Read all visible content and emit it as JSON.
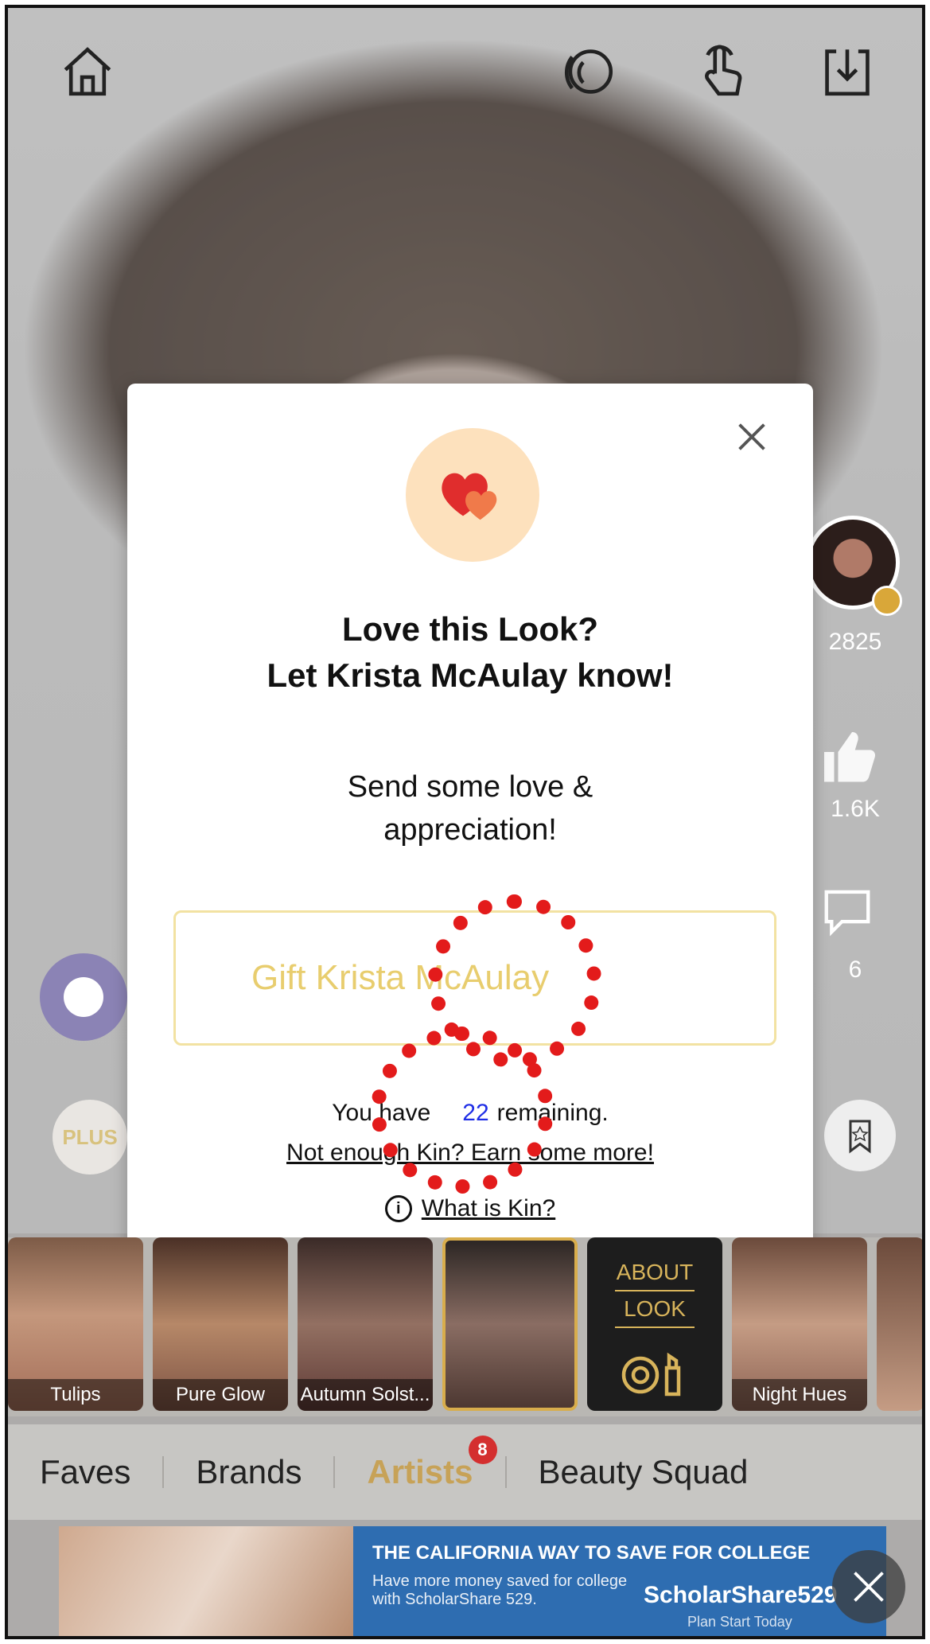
{
  "modal": {
    "title_line1": "Love this Look?",
    "title_line2": "Let Krista McAulay know!",
    "subtitle_line1": "Send some love &",
    "subtitle_line2": "appreciation!",
    "gift_button_label": "Gift Krista McAulay",
    "kin_prefix": "You have",
    "kin_count": "22",
    "kin_suffix": "remaining.",
    "earn_link": "Not enough Kin? Earn some more!",
    "what_is_kin": "What is Kin?"
  },
  "side": {
    "follower_count": "2825",
    "like_count": "1.6K",
    "comment_count": "6",
    "plus_label": "PLUS"
  },
  "thumbnails": [
    {
      "label": "Tulips"
    },
    {
      "label": "Pure Glow"
    },
    {
      "label": "Autumn Solst..."
    },
    {
      "label": ""
    },
    {
      "label": ""
    },
    {
      "label": "Night Hues"
    }
  ],
  "about_look": {
    "line1": "ABOUT",
    "line2": "LOOK"
  },
  "tabs": [
    {
      "label": "Faves"
    },
    {
      "label": "Brands"
    },
    {
      "label": "Artists",
      "badge": "8"
    },
    {
      "label": "Beauty Squad"
    }
  ],
  "ad": {
    "headline": "THE CALIFORNIA WAY TO SAVE FOR COLLEGE",
    "body": "Have more money saved for college with ScholarShare 529.",
    "brand": "ScholarShare529",
    "brand_sub": "Plan Start Today"
  },
  "colors": {
    "accent_gold": "#c7a257",
    "kin_blue": "#1f2ee6",
    "annotation_red": "#e31b1b",
    "heart_bg": "#fde1bd"
  }
}
